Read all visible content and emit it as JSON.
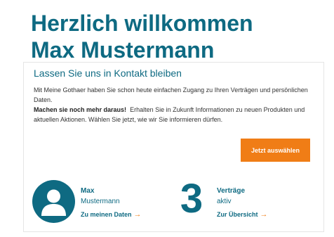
{
  "header": {
    "greeting": "Herzlich willkommen",
    "user_name": "Max Mustermann"
  },
  "contact_card": {
    "title": "Lassen Sie uns in Kontakt bleiben",
    "intro_text": "Mit Meine Gothaer haben Sie schon heute einfachen Zugang zu Ihren Verträgen und persönlichen Daten.",
    "highlight": "Machen sie noch mehr daraus!",
    "followup_text": "Erhalten Sie in Zukunft Informationen zu neuen Produkten und aktuellen Aktionen. Wählen Sie jetzt, wie wir Sie informieren dürfen.",
    "cta_label": "Jetzt auswählen"
  },
  "profile": {
    "first_name": "Max",
    "last_name": "Mustermann",
    "link_label": "Zu meinen Daten",
    "avatar_icon": "user-silhouette-icon"
  },
  "contracts": {
    "count": "3",
    "title": "Verträge",
    "status": "aktiv",
    "link_label": "Zur Übersicht"
  },
  "colors": {
    "primary": "#0e6a82",
    "accent": "#f07d16",
    "text": "#333333",
    "border": "#e5e5e5"
  },
  "icons": {
    "link_arrow": "arrow-right-icon"
  }
}
